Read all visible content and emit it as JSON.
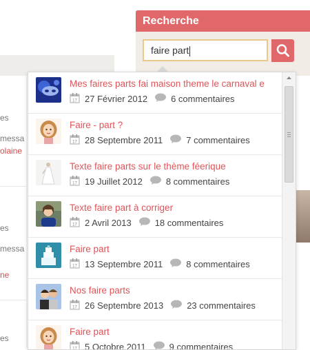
{
  "background": {
    "left_fragments": [
      {
        "text": "es",
        "red": false
      },
      {
        "text": "messa",
        "red": false
      },
      {
        "text": "olaine",
        "red": true
      },
      {
        "text": "es",
        "red": false
      },
      {
        "text": "messa",
        "red": false
      },
      {
        "text": "ne",
        "red": true
      },
      {
        "text": "es",
        "red": false
      }
    ]
  },
  "search": {
    "title": "Recherche",
    "query": "faire part",
    "button_icon": "search-icon"
  },
  "results": [
    {
      "title": "Mes faires parts fai maison theme le carnaval e",
      "date": "27 Février 2012",
      "comments": "6 commentaires",
      "thumb": "mask"
    },
    {
      "title": "Faire - part ?",
      "date": "28 Septembre 2011",
      "comments": "7 commentaires",
      "thumb": "girl"
    },
    {
      "title": "Texte faire parts sur le thème féerique",
      "date": "19 Juillet 2012",
      "comments": "8 commentaires",
      "thumb": "dress"
    },
    {
      "title": "Texte faire part à corriger",
      "date": "2 Avril 2013",
      "comments": "18 commentaires",
      "thumb": "woman"
    },
    {
      "title": "Faire part",
      "date": "13 Septembre 2011",
      "comments": "8 commentaires",
      "thumb": "cake"
    },
    {
      "title": "Nos faire parts",
      "date": "26 Septembre 2013",
      "comments": "23 commentaires",
      "thumb": "couple"
    },
    {
      "title": "Faire part",
      "date": "5 Octobre 2011",
      "comments": "9 commentaires",
      "thumb": "girl"
    }
  ],
  "colors": {
    "accent": "#e0686a",
    "link": "#e05358",
    "input_border": "#e8c98a"
  },
  "icons": {
    "date": "calendar-icon",
    "comments": "speech-bubble-icon"
  }
}
